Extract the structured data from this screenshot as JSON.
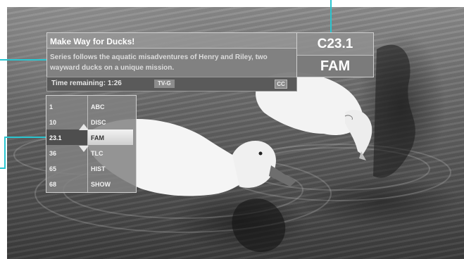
{
  "program": {
    "title": "Make Way for Ducks!",
    "description": "Series follows the aquatic misadventures of Henry and Riley, two wayward ducks on a unique mission.",
    "time_remaining": "Time remaining: 1:26",
    "rating": "TV-G",
    "cc": "CC"
  },
  "current_channel": {
    "number": "C23.1",
    "name": "FAM"
  },
  "channel_list": [
    {
      "number": "1",
      "name": "ABC"
    },
    {
      "number": "10",
      "name": "DISC"
    },
    {
      "number": "23.1",
      "name": "FAM",
      "selected": true
    },
    {
      "number": "36",
      "name": "TLC"
    },
    {
      "number": "65",
      "name": "HIST"
    },
    {
      "number": "68",
      "name": "SHOW"
    }
  ],
  "icons": {
    "up": "up-arrow-icon",
    "down": "down-arrow-icon"
  },
  "colors": {
    "callout": "#29c5d0",
    "selected_bg": "#e6e6e6"
  }
}
